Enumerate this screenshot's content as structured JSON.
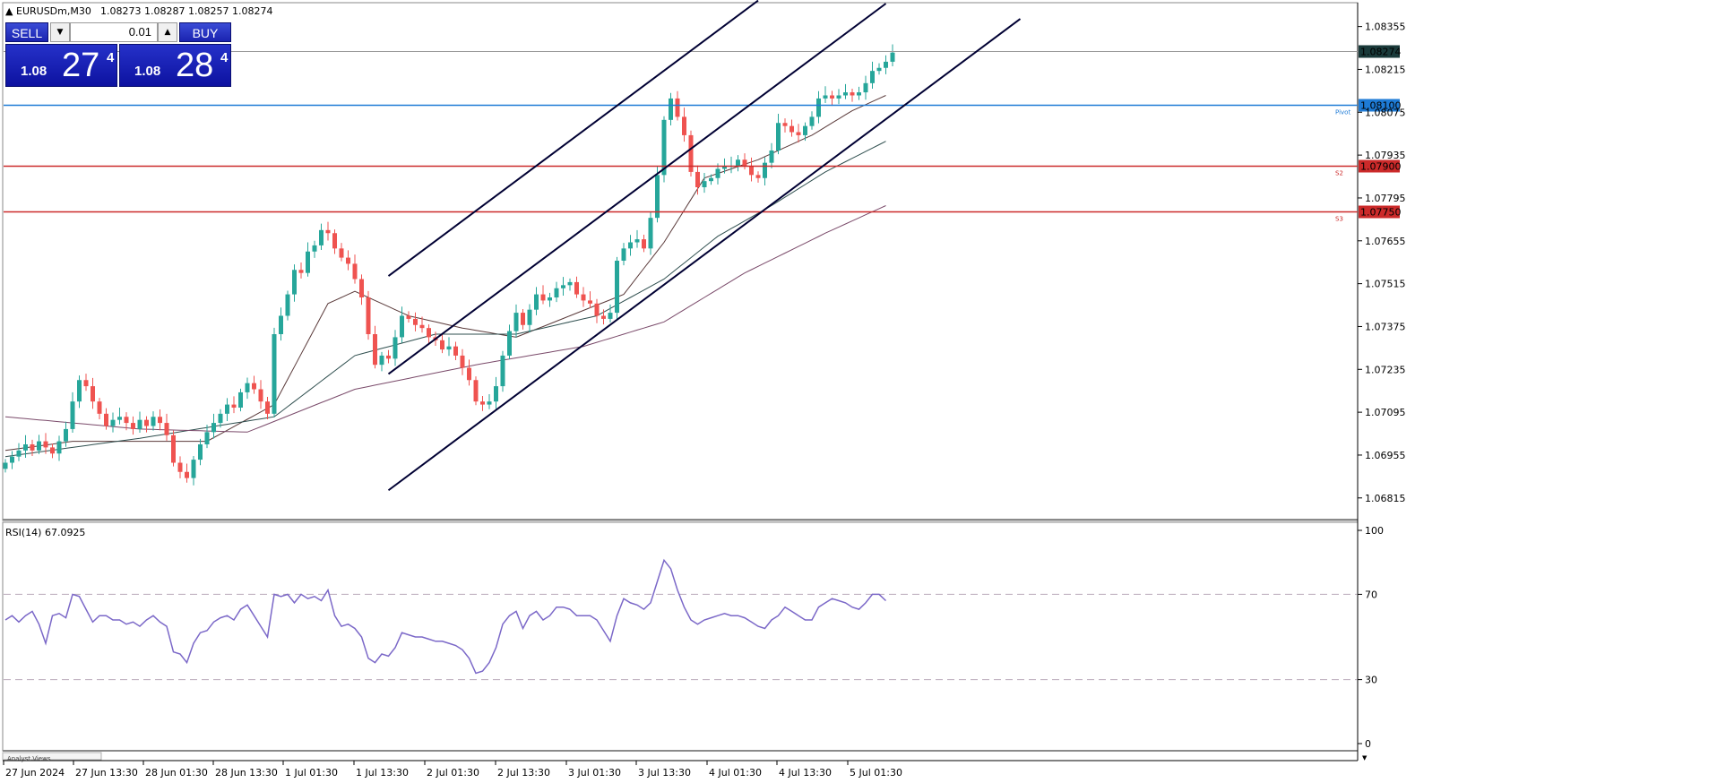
{
  "header": {
    "symbol": "EURUSDm,M30",
    "ohlc": "1.08273 1.08287 1.08257 1.08274"
  },
  "trade_panel": {
    "sell_label": "SELL",
    "buy_label": "BUY",
    "lot": "0.01",
    "sell_prefix": "1.08",
    "sell_big": "27",
    "sell_sup": "4",
    "buy_prefix": "1.08",
    "buy_big": "28",
    "buy_sup": "4"
  },
  "colors": {
    "bull": "#26a69a",
    "bear": "#ef5350",
    "ma_fast": "#5a3a3a",
    "ma_mid": "#2f4f4f",
    "ma_slow": "#7a4a6a",
    "channel": "#000033",
    "pivot": "#1e7bd6",
    "support": "#cc2a2a",
    "rsi": "#7b68c8",
    "current_price_bg": "#1a3a3a"
  },
  "chart_data": [
    {
      "type": "candlestick",
      "title": "EURUSDm,M30",
      "x_tick_labels": [
        "27 Jun 2024",
        "27 Jun 13:30",
        "28 Jun 01:30",
        "28 Jun 13:30",
        "1 Jul 01:30",
        "1 Jul 13:30",
        "2 Jul 01:30",
        "2 Jul 13:30",
        "3 Jul 01:30",
        "3 Jul 13:30",
        "4 Jul 01:30",
        "4 Jul 13:30",
        "5 Jul 01:30"
      ],
      "y_tick_labels": [
        "1.08355",
        "1.08215",
        "1.08075",
        "1.07935",
        "1.07795",
        "1.07655",
        "1.07515",
        "1.07375",
        "1.07235",
        "1.07095",
        "1.06955",
        "1.06815"
      ],
      "ylim": [
        1.0675,
        1.0843
      ],
      "bar_count": 132,
      "closes": [
        1.0693,
        1.0695,
        1.0697,
        1.0699,
        1.0697,
        1.07,
        1.0698,
        1.0696,
        1.07,
        1.0704,
        1.0713,
        1.072,
        1.0718,
        1.0713,
        1.0709,
        1.0705,
        1.0707,
        1.0708,
        1.0706,
        1.0704,
        1.0707,
        1.0705,
        1.0708,
        1.0706,
        1.0702,
        1.0693,
        1.069,
        1.0688,
        1.0694,
        1.0699,
        1.0703,
        1.0706,
        1.0709,
        1.0712,
        1.0711,
        1.0716,
        1.0719,
        1.0717,
        1.0713,
        1.0709,
        1.0735,
        1.0741,
        1.0748,
        1.0756,
        1.0755,
        1.0762,
        1.0764,
        1.0769,
        1.0768,
        1.0763,
        1.076,
        1.0758,
        1.0753,
        1.0747,
        1.0735,
        1.0725,
        1.0728,
        1.0727,
        1.0734,
        1.0741,
        1.074,
        1.0738,
        1.0737,
        1.0734,
        1.0733,
        1.073,
        1.0731,
        1.0728,
        1.0724,
        1.072,
        1.0713,
        1.0712,
        1.0713,
        1.0718,
        1.0728,
        1.0736,
        1.0742,
        1.0738,
        1.0743,
        1.0748,
        1.0746,
        1.0747,
        1.075,
        1.0751,
        1.0752,
        1.0748,
        1.0746,
        1.0745,
        1.0741,
        1.074,
        1.0742,
        1.0759,
        1.0763,
        1.0765,
        1.0766,
        1.0763,
        1.0773,
        1.0787,
        1.0805,
        1.0812,
        1.0806,
        1.08,
        1.0788,
        1.0783,
        1.0785,
        1.0786,
        1.0789,
        1.079,
        1.079,
        1.0792,
        1.079,
        1.0787,
        1.0786,
        1.0791,
        1.0795,
        1.0804,
        1.0803,
        1.0801,
        1.08,
        1.0803,
        1.0806,
        1.0812,
        1.0813,
        1.0812,
        1.0813,
        1.0814,
        1.0813,
        1.0814,
        1.0817,
        1.0821,
        1.0822,
        1.0824,
        1.0827
      ],
      "moving_averages": [
        {
          "anchors": [
            [
              0,
              1.0697
            ],
            [
              10,
              1.07
            ],
            [
              20,
              1.07
            ],
            [
              30,
              1.07
            ],
            [
              40,
              1.0712
            ],
            [
              48,
              1.0745
            ],
            [
              52,
              1.0749
            ],
            [
              60,
              1.0741
            ],
            [
              68,
              1.0737
            ],
            [
              76,
              1.0734
            ],
            [
              84,
              1.0741
            ],
            [
              92,
              1.0748
            ],
            [
              98,
              1.0765
            ],
            [
              104,
              1.0786
            ],
            [
              112,
              1.0792
            ],
            [
              120,
              1.08
            ],
            [
              126,
              1.0808
            ],
            [
              131,
              1.0813
            ]
          ]
        },
        {
          "anchors": [
            [
              0,
              1.0695
            ],
            [
              20,
              1.0701
            ],
            [
              40,
              1.0708
            ],
            [
              52,
              1.0728
            ],
            [
              64,
              1.0735
            ],
            [
              76,
              1.0735
            ],
            [
              88,
              1.0741
            ],
            [
              98,
              1.0753
            ],
            [
              106,
              1.0767
            ],
            [
              114,
              1.0777
            ],
            [
              122,
              1.0788
            ],
            [
              131,
              1.0798
            ]
          ]
        },
        {
          "anchors": [
            [
              0,
              1.0708
            ],
            [
              20,
              1.0704
            ],
            [
              36,
              1.0703
            ],
            [
              52,
              1.0717
            ],
            [
              70,
              1.0725
            ],
            [
              86,
              1.0731
            ],
            [
              98,
              1.0739
            ],
            [
              110,
              1.0755
            ],
            [
              122,
              1.0768
            ],
            [
              131,
              1.0777
            ]
          ]
        }
      ],
      "channel_lines": [
        [
          [
            57,
            1.0754
          ],
          [
            112,
            1.0844
          ]
        ],
        [
          [
            57,
            1.0722
          ],
          [
            131,
            1.0843
          ]
        ],
        [
          [
            57,
            1.0684
          ],
          [
            151,
            1.0838
          ]
        ]
      ],
      "levels": [
        {
          "price": 1.08274,
          "label": "1.08274",
          "kind": "current",
          "marker": ""
        },
        {
          "price": 1.081,
          "label": "1.08100",
          "kind": "pivot",
          "marker": "Pivot"
        },
        {
          "price": 1.079,
          "label": "1.07900",
          "kind": "support",
          "marker": "S2"
        },
        {
          "price": 1.0775,
          "label": "1.07750",
          "kind": "support",
          "marker": "S3"
        }
      ]
    },
    {
      "type": "line",
      "title": "RSI(14) 67.0925",
      "ylim": [
        0,
        100
      ],
      "y_tick_labels": [
        "100",
        "70",
        "30",
        "0"
      ],
      "levels": [
        70,
        30
      ],
      "values": [
        58,
        60,
        57,
        60,
        62,
        56,
        47,
        60,
        61,
        59,
        70,
        69,
        63,
        57,
        60,
        60,
        58,
        58,
        56,
        57,
        55,
        58,
        60,
        57,
        55,
        43,
        42,
        38,
        47,
        52,
        53,
        57,
        59,
        60,
        58,
        63,
        65,
        60,
        55,
        50,
        70,
        69,
        70,
        66,
        70,
        68,
        69,
        67,
        72,
        60,
        55,
        56,
        54,
        50,
        40,
        38,
        42,
        41,
        45,
        52,
        51,
        50,
        50,
        49,
        48,
        48,
        47,
        46,
        44,
        40,
        33,
        34,
        38,
        45,
        56,
        60,
        62,
        54,
        60,
        62,
        58,
        60,
        64,
        64,
        63,
        60,
        60,
        60,
        58,
        53,
        48,
        60,
        68,
        66,
        65,
        63,
        66,
        76,
        86,
        82,
        72,
        64,
        58,
        56,
        58,
        59,
        60,
        61,
        60,
        60,
        59,
        57,
        55,
        54,
        58,
        60,
        64,
        62,
        60,
        58,
        58,
        64,
        66,
        68,
        67,
        66,
        64,
        63,
        66,
        70,
        70,
        67
      ]
    }
  ]
}
